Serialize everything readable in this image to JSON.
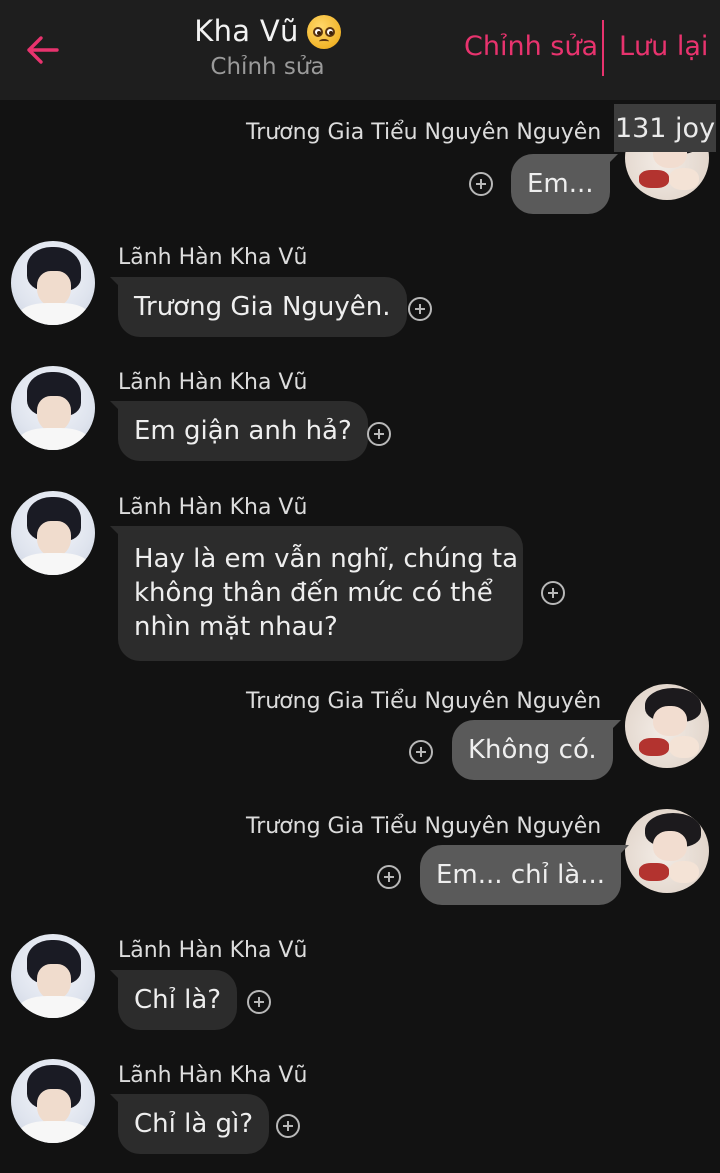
{
  "header": {
    "title": "Kha Vũ",
    "subtitle": "Chỉnh sửa",
    "edit_label": "Chỉnh sửa",
    "save_label": "Lưu lại",
    "accent_color": "#e8336e"
  },
  "badge": {
    "text": "131 joy"
  },
  "messages": [
    {
      "side": "out",
      "sender": "Trương Gia Tiểu Nguyên Nguyên",
      "text": "Em..."
    },
    {
      "side": "in",
      "sender": "Lãnh Hàn Kha Vũ",
      "text": "Trương Gia Nguyên."
    },
    {
      "side": "in",
      "sender": "Lãnh Hàn Kha Vũ",
      "text": "Em giận anh hả?"
    },
    {
      "side": "in",
      "sender": "Lãnh Hàn Kha Vũ",
      "lines": [
        "Hay là em vẫn nghĩ, chúng ta",
        "không thân đến mức có thể",
        "nhìn mặt nhau?"
      ]
    },
    {
      "side": "out",
      "sender": "Trương Gia Tiểu Nguyên Nguyên",
      "text": "Không có."
    },
    {
      "side": "out",
      "sender": "Trương Gia Tiểu Nguyên Nguyên",
      "text": "Em... chỉ là..."
    },
    {
      "side": "in",
      "sender": "Lãnh Hàn Kha Vũ",
      "text": "Chỉ là?"
    },
    {
      "side": "in",
      "sender": "Lãnh Hàn Kha Vũ",
      "text": "Chỉ là gì?"
    }
  ]
}
